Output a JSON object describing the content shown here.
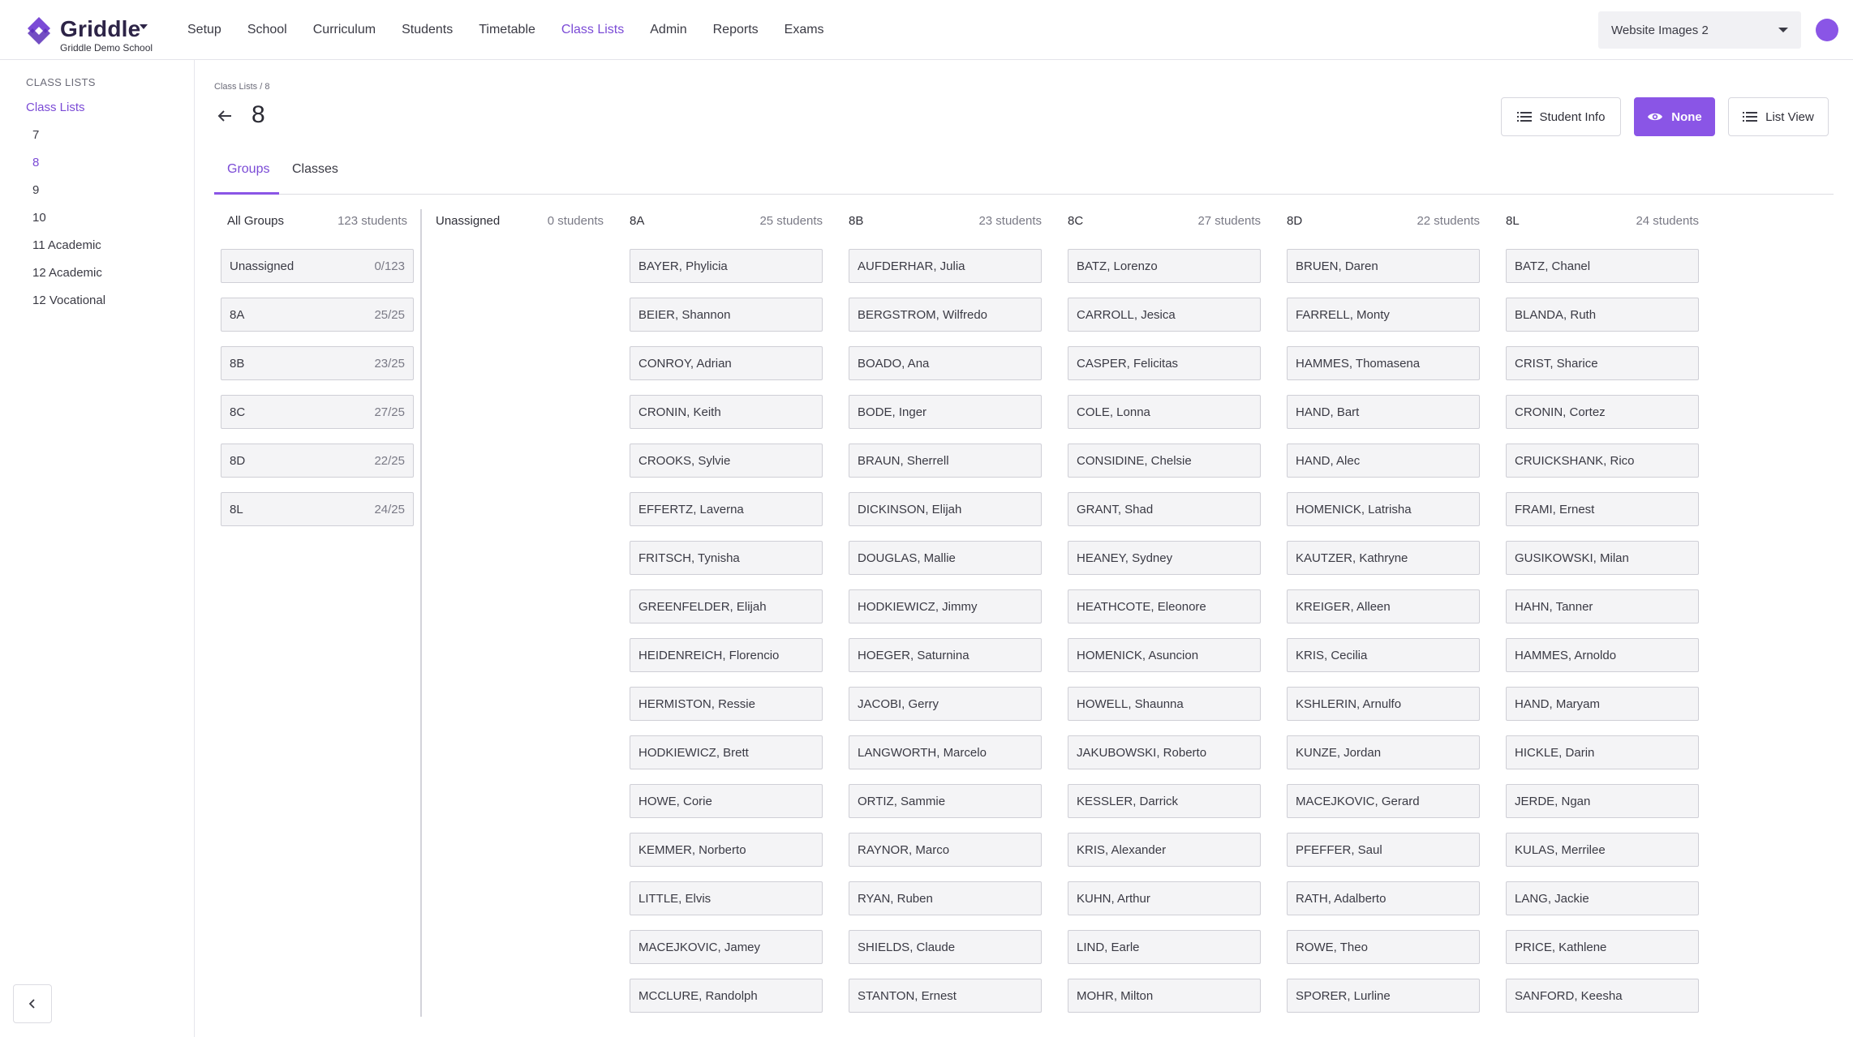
{
  "app": {
    "brand": "Griddle",
    "school": "Griddle Demo School",
    "workspace": "Website Images 2",
    "accent": "#8a55e6"
  },
  "nav": [
    "Setup",
    "School",
    "Curriculum",
    "Students",
    "Timetable",
    "Class Lists",
    "Admin",
    "Reports",
    "Exams"
  ],
  "nav_active": "Class Lists",
  "sidebar": {
    "section": "CLASS LISTS",
    "parent": "Class Lists",
    "items": [
      "7",
      "8",
      "9",
      "10",
      "11 Academic",
      "12 Academic",
      "12 Vocational"
    ],
    "active": "8"
  },
  "header": {
    "breadcrumb": "Class Lists / 8",
    "title": "8",
    "buttons": {
      "student_info": "Student Info",
      "none": "None",
      "list_view": "List View"
    }
  },
  "tabs": [
    "Groups",
    "Classes"
  ],
  "all_groups": {
    "label": "All Groups",
    "count": "123 students",
    "groups": [
      {
        "name": "Unassigned",
        "fraction": "0/123"
      },
      {
        "name": "8A",
        "fraction": "25/25"
      },
      {
        "name": "8B",
        "fraction": "23/25"
      },
      {
        "name": "8C",
        "fraction": "27/25"
      },
      {
        "name": "8D",
        "fraction": "22/25"
      },
      {
        "name": "8L",
        "fraction": "24/25"
      }
    ]
  },
  "columns": [
    {
      "name": "Unassigned",
      "count": "0 students",
      "students": []
    },
    {
      "name": "8A",
      "count": "25 students",
      "students": [
        "BAYER, Phylicia",
        "BEIER, Shannon",
        "CONROY, Adrian",
        "CRONIN, Keith",
        "CROOKS, Sylvie",
        "EFFERTZ, Laverna",
        "FRITSCH, Tynisha",
        "GREENFELDER, Elijah",
        "HEIDENREICH, Florencio",
        "HERMISTON, Ressie",
        "HODKIEWICZ, Brett",
        "HOWE, Corie",
        "KEMMER, Norberto",
        "LITTLE, Elvis",
        "MACEJKOVIC, Jamey",
        "MCCLURE, Randolph"
      ]
    },
    {
      "name": "8B",
      "count": "23 students",
      "students": [
        "AUFDERHAR, Julia",
        "BERGSTROM, Wilfredo",
        "BOADO, Ana",
        "BODE, Inger",
        "BRAUN, Sherrell",
        "DICKINSON, Elijah",
        "DOUGLAS, Mallie",
        "HODKIEWICZ, Jimmy",
        "HOEGER, Saturnina",
        "JACOBI, Gerry",
        "LANGWORTH, Marcelo",
        "ORTIZ, Sammie",
        "RAYNOR, Marco",
        "RYAN, Ruben",
        "SHIELDS, Claude",
        "STANTON, Ernest"
      ]
    },
    {
      "name": "8C",
      "count": "27 students",
      "students": [
        "BATZ, Lorenzo",
        "CARROLL, Jesica",
        "CASPER, Felicitas",
        "COLE, Lonna",
        "CONSIDINE, Chelsie",
        "GRANT, Shad",
        "HEANEY, Sydney",
        "HEATHCOTE, Eleonore",
        "HOMENICK, Asuncion",
        "HOWELL, Shaunna",
        "JAKUBOWSKI, Roberto",
        "KESSLER, Darrick",
        "KRIS, Alexander",
        "KUHN, Arthur",
        "LIND, Earle",
        "MOHR, Milton"
      ]
    },
    {
      "name": "8D",
      "count": "22 students",
      "students": [
        "BRUEN, Daren",
        "FARRELL, Monty",
        "HAMMES, Thomasena",
        "HAND, Bart",
        "HAND, Alec",
        "HOMENICK, Latrisha",
        "KAUTZER, Kathryne",
        "KREIGER, Alleen",
        "KRIS, Cecilia",
        "KSHLERIN, Arnulfo",
        "KUNZE, Jordan",
        "MACEJKOVIC, Gerard",
        "PFEFFER, Saul",
        "RATH, Adalberto",
        "ROWE, Theo",
        "SPORER, Lurline"
      ]
    },
    {
      "name": "8L",
      "count": "24 students",
      "students": [
        "BATZ, Chanel",
        "BLANDA, Ruth",
        "CRIST, Sharice",
        "CRONIN, Cortez",
        "CRUICKSHANK, Rico",
        "FRAMI, Ernest",
        "GUSIKOWSKI, Milan",
        "HAHN, Tanner",
        "HAMMES, Arnoldo",
        "HAND, Maryam",
        "HICKLE, Darin",
        "JERDE, Ngan",
        "KULAS, Merrilee",
        "LANG, Jackie",
        "PRICE, Kathlene",
        "SANFORD, Keesha"
      ]
    }
  ]
}
